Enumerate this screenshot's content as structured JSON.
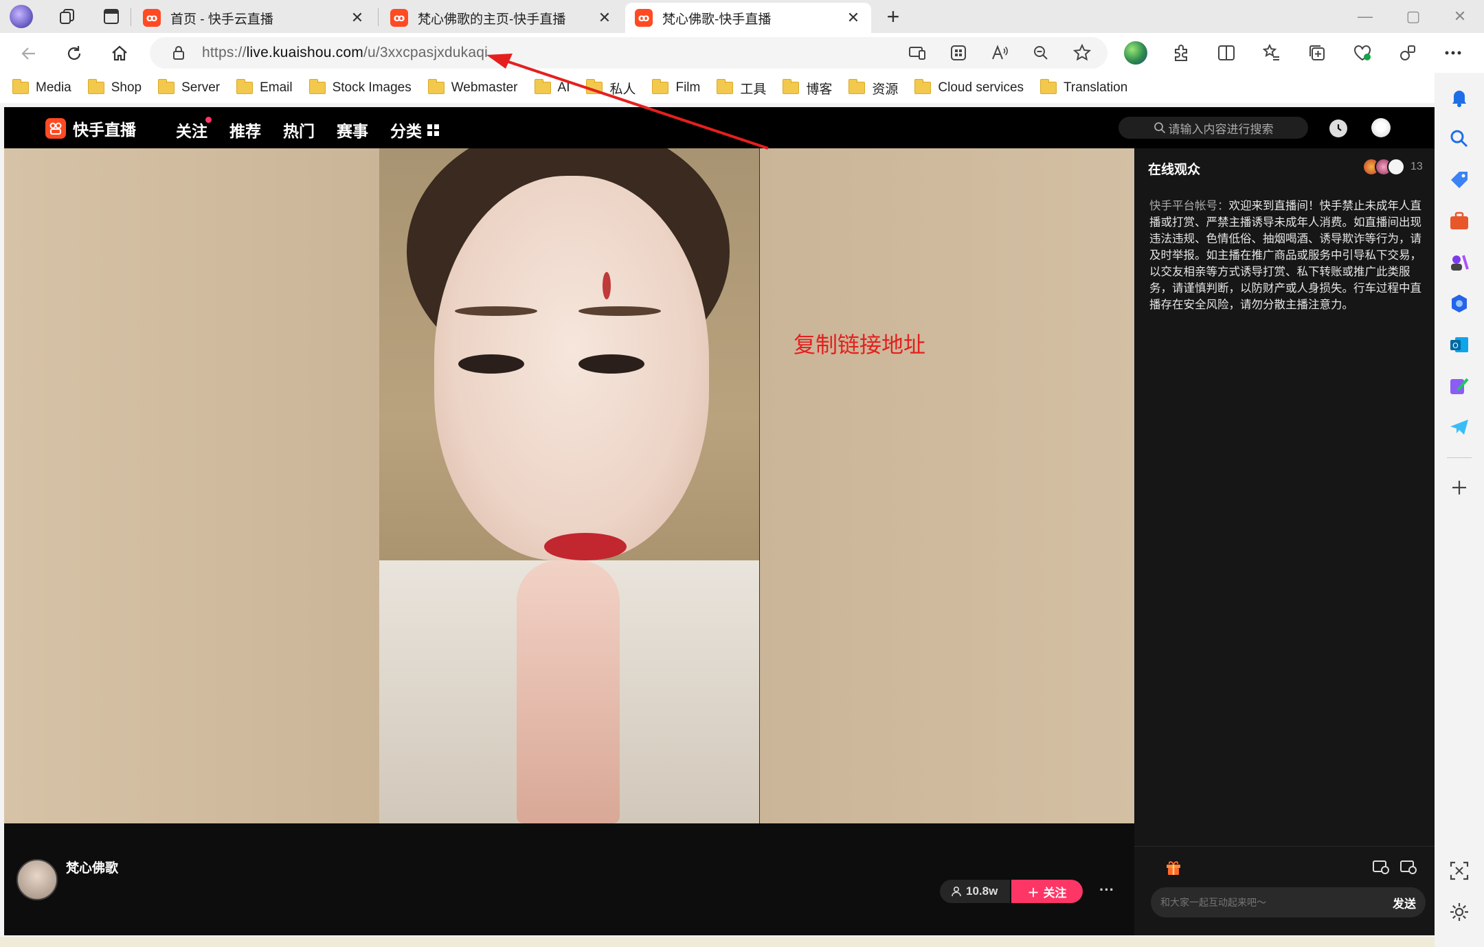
{
  "browser": {
    "tabs": [
      {
        "title": "首页 - 快手云直播",
        "active": false
      },
      {
        "title": "梵心佛歌的主页-快手直播",
        "active": false
      },
      {
        "title": "梵心佛歌-快手直播",
        "active": true
      }
    ],
    "new_tab": "+",
    "window_controls": {
      "minimize": "—",
      "maximize": "▢",
      "close": "✕"
    },
    "url": {
      "protocol": "https://",
      "host": "live.kuaishou.com",
      "path": "/u/3xxcpasjxdukaqi"
    },
    "favorites": [
      "Media",
      "Shop",
      "Server",
      "Email",
      "Stock Images",
      "Webmaster",
      "AI",
      "私人",
      "Film",
      "工具",
      "博客",
      "资源",
      "Cloud services",
      "Translation"
    ]
  },
  "site": {
    "logo_text": "快手直播",
    "nav": [
      "关注",
      "推荐",
      "热门",
      "赛事",
      "分类"
    ],
    "search_placeholder": "请输入内容进行搜索"
  },
  "overlay_annotation": "复制链接地址",
  "streamer": {
    "name": "梵心佛歌",
    "viewers": "10.8w",
    "follow_label": "关注",
    "more": "···"
  },
  "chat": {
    "heading": "在线观众",
    "viewer_count": "13",
    "notice_source": "快手平台帐号：",
    "notice_text": "欢迎来到直播间！快手禁止未成年人直播或打赏、严禁主播诱导未成年人消费。如直播间出现违法违规、色情低俗、抽烟喝酒、诱导欺诈等行为，请及时举报。如主播在推广商品或服务中引导私下交易，以交友相亲等方式诱导打赏、私下转账或推广此类服务，请谨慎判断，以防财产或人身损失。行车过程中直播存在安全风险，请勿分散主播注意力。",
    "input_placeholder": "和大家一起互动起来吧～",
    "send_label": "发送"
  },
  "colors": {
    "brand": "#ff4a22",
    "follow": "#fe3666",
    "annotation": "#e4201e"
  }
}
